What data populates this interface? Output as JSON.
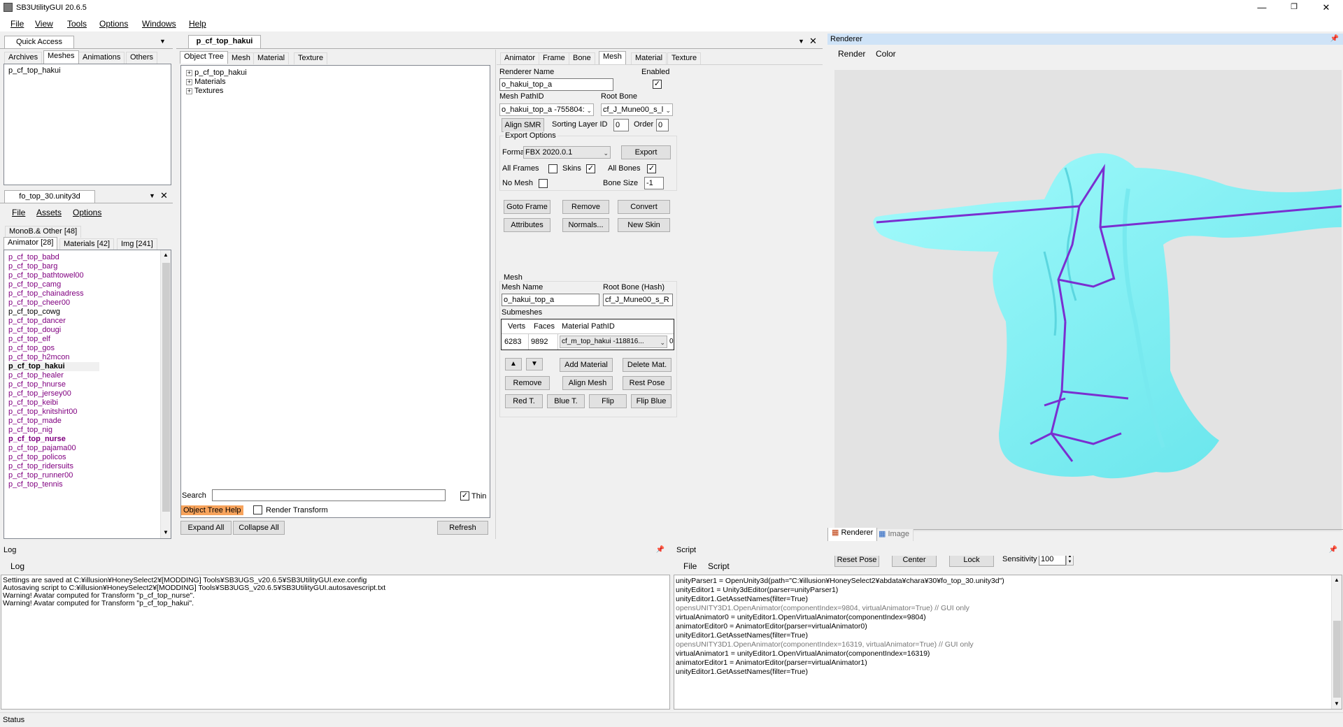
{
  "app": {
    "title": "SB3UtilityGUI 20.6.5"
  },
  "menu": [
    "File",
    "View",
    "Tools",
    "Options",
    "Windows",
    "Help"
  ],
  "quick_access": {
    "title": "Quick Access",
    "tabs": [
      "Archives",
      "Meshes",
      "Animations",
      "Others"
    ],
    "items": [
      "p_cf_top_hakui"
    ]
  },
  "unity_file": {
    "title": "fo_top_30.unity3d",
    "menu": [
      "File",
      "Assets",
      "Options"
    ],
    "tabs_row1": [
      "MonoB.& Other [48]"
    ],
    "tabs_row2": [
      "Animator [28]",
      "Materials [42]",
      "Img [241]"
    ],
    "items": [
      {
        "name": "p_cf_top_babd",
        "style": "purple"
      },
      {
        "name": "p_cf_top_barg",
        "style": "purple"
      },
      {
        "name": "p_cf_top_bathtowel00",
        "style": "purple"
      },
      {
        "name": "p_cf_top_camg",
        "style": "purple"
      },
      {
        "name": "p_cf_top_chainadress",
        "style": "purple"
      },
      {
        "name": "p_cf_top_cheer00",
        "style": "purple"
      },
      {
        "name": "p_cf_top_cowg",
        "style": "black"
      },
      {
        "name": "p_cf_top_dancer",
        "style": "purple"
      },
      {
        "name": "p_cf_top_dougi",
        "style": "purple"
      },
      {
        "name": "p_cf_top_elf",
        "style": "purple"
      },
      {
        "name": "p_cf_top_gos",
        "style": "purple"
      },
      {
        "name": "p_cf_top_h2mcon",
        "style": "purple"
      },
      {
        "name": "p_cf_top_hakui",
        "style": "bold"
      },
      {
        "name": "p_cf_top_healer",
        "style": "purple"
      },
      {
        "name": "p_cf_top_hnurse",
        "style": "purple"
      },
      {
        "name": "p_cf_top_jersey00",
        "style": "purple"
      },
      {
        "name": "p_cf_top_keibi",
        "style": "purple"
      },
      {
        "name": "p_cf_top_knitshirt00",
        "style": "purple"
      },
      {
        "name": "p_cf_top_made",
        "style": "purple"
      },
      {
        "name": "p_cf_top_nig",
        "style": "purple"
      },
      {
        "name": "p_cf_top_nurse",
        "style": "boldpurple"
      },
      {
        "name": "p_cf_top_pajama00",
        "style": "purple"
      },
      {
        "name": "p_cf_top_policos",
        "style": "purple"
      },
      {
        "name": "p_cf_top_ridersuits",
        "style": "purple"
      },
      {
        "name": "p_cf_top_runner00",
        "style": "purple"
      },
      {
        "name": "p_cf_top_tennis",
        "style": "purple"
      }
    ]
  },
  "editor": {
    "doc_tab": "p_cf_top_hakui",
    "tabs": [
      "Object Tree",
      "Mesh",
      "Material",
      "Texture"
    ],
    "tree": [
      "p_cf_top_hakui",
      "Materials",
      "Textures"
    ],
    "search_label": "Search",
    "search_value": "",
    "thin_label": "Thin",
    "object_tree_help": "Object Tree Help",
    "render_transform": "Render Transform",
    "expand_all": "Expand All",
    "collapse_all": "Collapse All",
    "refresh": "Refresh"
  },
  "mesh_panel": {
    "tabs": [
      "Animator",
      "Frame",
      "Bone",
      "Mesh",
      "Material",
      "Texture"
    ],
    "renderer_name_label": "Renderer Name",
    "enabled_label": "Enabled",
    "renderer_name": "o_hakui_top_a",
    "mesh_pathid_label": "Mesh PathID",
    "root_bone_label": "Root Bone",
    "mesh_pathid": "o_hakui_top_a -755804:",
    "root_bone": "cf_J_Mune00_s_l",
    "align_smr": "Align SMR",
    "sorting_layer_label": "Sorting Layer ID",
    "sorting_layer": "0",
    "order_label": "Order",
    "order": "0",
    "export_options": "Export Options",
    "format_label": "Format",
    "format": "FBX 2020.0.1",
    "export": "Export",
    "all_frames": "All Frames",
    "skins": "Skins",
    "all_bones": "All Bones",
    "no_mesh": "No Mesh",
    "bone_size_label": "Bone Size",
    "bone_size": "-1",
    "goto_frame": "Goto Frame",
    "remove": "Remove",
    "convert": "Convert",
    "attributes": "Attributes",
    "normals": "Normals...",
    "new_skin": "New Skin",
    "mesh_group": "Mesh",
    "mesh_name_label": "Mesh Name",
    "root_bone_hash_label": "Root Bone (Hash)",
    "mesh_name": "o_hakui_top_a",
    "root_bone_hash": "cf_J_Mune00_s_R",
    "submeshes_label": "Submeshes",
    "submesh_headers": [
      "Verts",
      "Faces",
      "Material PathID"
    ],
    "submesh_row": {
      "verts": "6283",
      "faces": "9892",
      "material": "cf_m_top_hakui -118816...",
      "extra": "0"
    },
    "add_material": "Add Material",
    "delete_mat": "Delete Mat.",
    "remove2": "Remove",
    "align_mesh": "Align Mesh",
    "rest_pose": "Rest Pose",
    "red_t": "Red T.",
    "blue_t": "Blue T.",
    "flip": "Flip",
    "flip_blue": "Flip Blue"
  },
  "renderer": {
    "title": "Renderer",
    "menu": [
      "Render",
      "Color"
    ],
    "reset_pose": "Reset Pose",
    "center": "Center",
    "lock": "Lock",
    "sensitivity_label": "Sensitivity",
    "sensitivity": "100",
    "tabs": [
      "Renderer",
      "Image"
    ],
    "mesh_color": "#7ef4f6"
  },
  "log": {
    "title": "Log",
    "menu": [
      "Log"
    ],
    "lines": [
      "Settings are saved at C:¥illusion¥HoneySelect2¥[MODDING] Tools¥SB3UGS_v20.6.5¥SB3UtilityGUI.exe.config",
      "Autosaving script to C:¥illusion¥HoneySelect2¥[MODDING] Tools¥SB3UGS_v20.6.5¥SB3UtilityGUI.autosavescript.txt",
      "Warning! Avatar computed for Transform \"p_cf_top_nurse\".",
      "Warning! Avatar computed for Transform \"p_cf_top_hakui\"."
    ]
  },
  "script": {
    "title": "Script",
    "menu": [
      "File",
      "Script"
    ],
    "lines": [
      {
        "text": "unityParser1 = OpenUnity3d(path=\"C:¥illusion¥HoneySelect2¥abdata¥chara¥30¥fo_top_30.unity3d\")",
        "gray": false
      },
      {
        "text": "unityEditor1 = Unity3dEditor(parser=unityParser1)",
        "gray": false
      },
      {
        "text": "unityEditor1.GetAssetNames(filter=True)",
        "gray": false
      },
      {
        "text": "opensUNITY3D1.OpenAnimator(componentIndex=9804, virtualAnimator=True) // GUI only",
        "gray": true
      },
      {
        "text": "virtualAnimator0 = unityEditor1.OpenVirtualAnimator(componentIndex=9804)",
        "gray": false
      },
      {
        "text": "animatorEditor0 = AnimatorEditor(parser=virtualAnimator0)",
        "gray": false
      },
      {
        "text": "unityEditor1.GetAssetNames(filter=True)",
        "gray": false
      },
      {
        "text": "opensUNITY3D1.OpenAnimator(componentIndex=16319, virtualAnimator=True) // GUI only",
        "gray": true
      },
      {
        "text": "virtualAnimator1 = unityEditor1.OpenVirtualAnimator(componentIndex=16319)",
        "gray": false
      },
      {
        "text": "animatorEditor1 = AnimatorEditor(parser=virtualAnimator1)",
        "gray": false
      },
      {
        "text": "unityEditor1.GetAssetNames(filter=True)",
        "gray": false
      }
    ]
  },
  "status": "Status"
}
